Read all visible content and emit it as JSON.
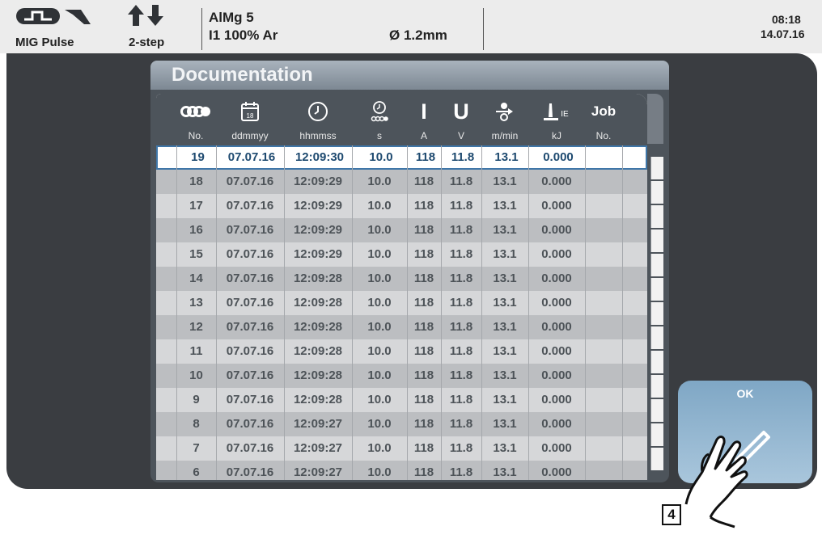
{
  "header": {
    "process_mode": "MIG Pulse",
    "trigger_mode": "2-step",
    "material": "AlMg 5",
    "gas": "I1 100% Ar",
    "wire_diameter": "Ø  1.2mm",
    "time": "08:18",
    "date": "14.07.16"
  },
  "panel": {
    "title": "Documentation"
  },
  "table": {
    "columns": [
      {
        "key": "no",
        "icon": "wire-spool-icon",
        "unit": "No."
      },
      {
        "key": "date",
        "icon": "calendar-icon",
        "icon_text": "18",
        "unit": "ddmmyy"
      },
      {
        "key": "time",
        "icon": "clock-icon",
        "unit": "hhmmss"
      },
      {
        "key": "duration",
        "icon": "timer-wire-icon",
        "unit": "s"
      },
      {
        "key": "current",
        "icon_text": "I",
        "unit": "A"
      },
      {
        "key": "voltage",
        "icon_text": "U",
        "unit": "V"
      },
      {
        "key": "wire_speed",
        "icon": "wire-feed-icon",
        "unit": "m/min"
      },
      {
        "key": "energy",
        "icon": "energy-ie-icon",
        "icon_text": "IE",
        "unit": "kJ"
      },
      {
        "key": "job",
        "icon_text": "Job",
        "unit": "No."
      }
    ],
    "rows": [
      [
        "19",
        "07.07.16",
        "12:09:30",
        "10.0",
        "118",
        "11.8",
        "13.1",
        "0.000",
        ""
      ],
      [
        "18",
        "07.07.16",
        "12:09:29",
        "10.0",
        "118",
        "11.8",
        "13.1",
        "0.000",
        ""
      ],
      [
        "17",
        "07.07.16",
        "12:09:29",
        "10.0",
        "118",
        "11.8",
        "13.1",
        "0.000",
        ""
      ],
      [
        "16",
        "07.07.16",
        "12:09:29",
        "10.0",
        "118",
        "11.8",
        "13.1",
        "0.000",
        ""
      ],
      [
        "15",
        "07.07.16",
        "12:09:29",
        "10.0",
        "118",
        "11.8",
        "13.1",
        "0.000",
        ""
      ],
      [
        "14",
        "07.07.16",
        "12:09:28",
        "10.0",
        "118",
        "11.8",
        "13.1",
        "0.000",
        ""
      ],
      [
        "13",
        "07.07.16",
        "12:09:28",
        "10.0",
        "118",
        "11.8",
        "13.1",
        "0.000",
        ""
      ],
      [
        "12",
        "07.07.16",
        "12:09:28",
        "10.0",
        "118",
        "11.8",
        "13.1",
        "0.000",
        ""
      ],
      [
        "11",
        "07.07.16",
        "12:09:28",
        "10.0",
        "118",
        "11.8",
        "13.1",
        "0.000",
        ""
      ],
      [
        "10",
        "07.07.16",
        "12:09:28",
        "10.0",
        "118",
        "11.8",
        "13.1",
        "0.000",
        ""
      ],
      [
        "9",
        "07.07.16",
        "12:09:28",
        "10.0",
        "118",
        "11.8",
        "13.1",
        "0.000",
        ""
      ],
      [
        "8",
        "07.07.16",
        "12:09:27",
        "10.0",
        "118",
        "11.8",
        "13.1",
        "0.000",
        ""
      ],
      [
        "7",
        "07.07.16",
        "12:09:27",
        "10.0",
        "118",
        "11.8",
        "13.1",
        "0.000",
        ""
      ],
      [
        "6",
        "07.07.16",
        "12:09:27",
        "10.0",
        "118",
        "11.8",
        "13.1",
        "0.000",
        ""
      ]
    ],
    "selected_row": 0
  },
  "ok_button": {
    "label": "OK",
    "icon": "pencil-icon"
  },
  "step_label": "4",
  "colors": {
    "frame": "#3a3d41",
    "panel": "#4d545b",
    "row_light": "#d6d7d9",
    "row_dark": "#bcbec1",
    "selection_border": "#3f76a8",
    "ok_button": "#8fb3cf"
  }
}
